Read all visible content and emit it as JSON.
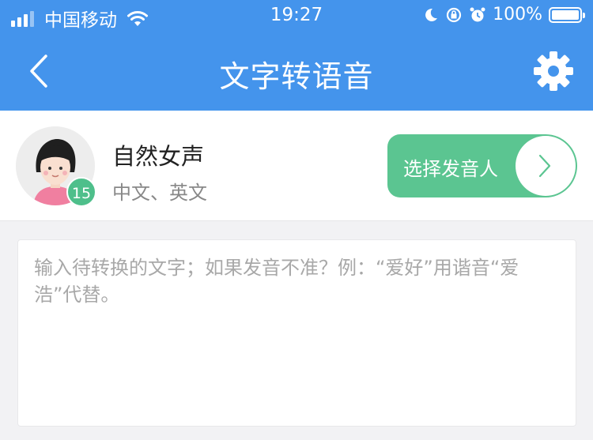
{
  "status_bar": {
    "carrier": "中国移动",
    "time": "19:27",
    "battery": "100%"
  },
  "nav": {
    "title": "文字转语音",
    "back_icon": "chevron-left-icon",
    "settings_icon": "gear-icon"
  },
  "voice": {
    "name": "自然女声",
    "languages": "中文、英文",
    "badge": "15",
    "choose_label": "选择发音人"
  },
  "editor": {
    "placeholder": "输入待转换的文字；如果发音不准？例：“爱好”用谐音“爱浩”代替。"
  },
  "colors": {
    "header": "#4494ec",
    "accent_green": "#5bc591",
    "badge_green": "#4ebf8b"
  }
}
